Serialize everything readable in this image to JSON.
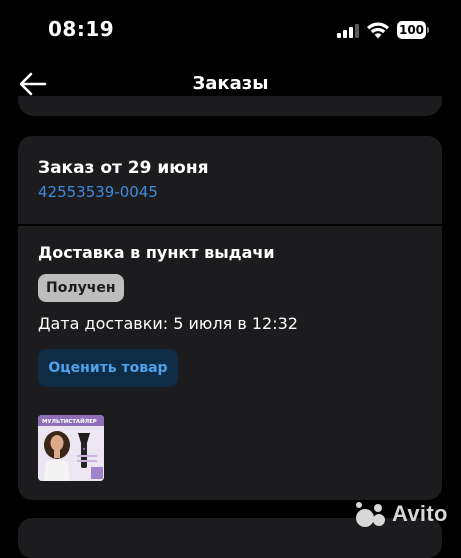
{
  "status_bar": {
    "time": "08:19",
    "battery": "100"
  },
  "header": {
    "title": "Заказы"
  },
  "order": {
    "title": "Заказ от 29 июня",
    "number": "42553539-0045",
    "delivery_type": "Доставка в пункт выдачи",
    "status": "Получен",
    "delivery_date": "Дата доставки: 5 июля в 12:32",
    "rate_button": "Оценить товар",
    "product_thumb_caption": "МУЛЬТИСТАЙЛЕР"
  },
  "watermark": {
    "text": "Avito"
  },
  "colors": {
    "background": "#000000",
    "card": "#1c1c1e",
    "link": "#3f8ae0",
    "badge": "#bdbdbd",
    "button_bg": "#0f2c47",
    "button_text": "#4ea3ec"
  }
}
